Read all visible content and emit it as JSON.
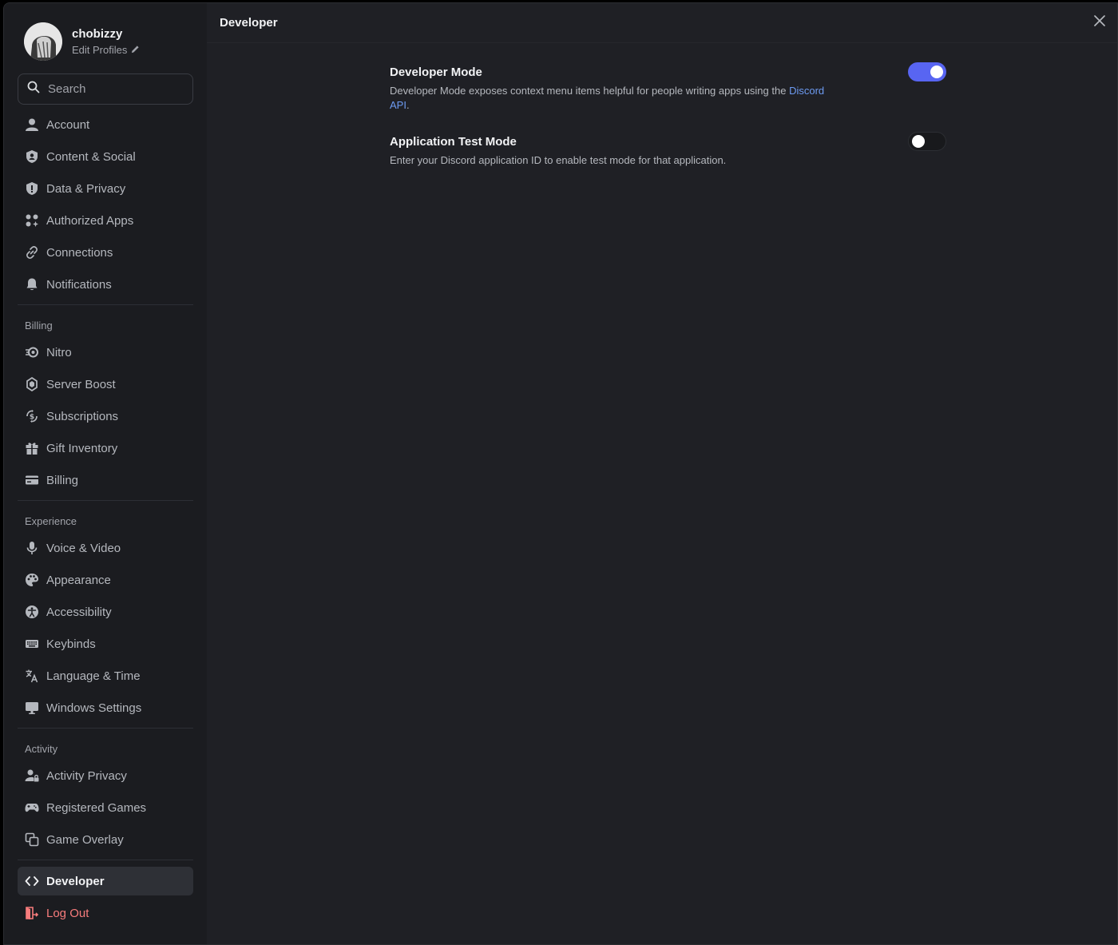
{
  "profile": {
    "username": "chobizzy",
    "edit_label": "Edit Profiles"
  },
  "search": {
    "placeholder": "Search"
  },
  "nav": {
    "user_items": [
      {
        "label": "Account",
        "icon": "user-icon"
      },
      {
        "label": "Content & Social",
        "icon": "shield-user-icon"
      },
      {
        "label": "Data & Privacy",
        "icon": "shield-icon"
      },
      {
        "label": "Authorized Apps",
        "icon": "apps-icon"
      },
      {
        "label": "Connections",
        "icon": "link-icon"
      },
      {
        "label": "Notifications",
        "icon": "bell-icon"
      }
    ],
    "billing_label": "Billing",
    "billing_items": [
      {
        "label": "Nitro",
        "icon": "nitro-icon"
      },
      {
        "label": "Server Boost",
        "icon": "boost-icon"
      },
      {
        "label": "Subscriptions",
        "icon": "subscriptions-icon"
      },
      {
        "label": "Gift Inventory",
        "icon": "gift-icon"
      },
      {
        "label": "Billing",
        "icon": "card-icon"
      }
    ],
    "experience_label": "Experience",
    "experience_items": [
      {
        "label": "Voice & Video",
        "icon": "mic-icon"
      },
      {
        "label": "Appearance",
        "icon": "palette-icon"
      },
      {
        "label": "Accessibility",
        "icon": "accessibility-icon"
      },
      {
        "label": "Keybinds",
        "icon": "keyboard-icon"
      },
      {
        "label": "Language & Time",
        "icon": "translate-icon"
      },
      {
        "label": "Windows Settings",
        "icon": "monitor-icon"
      }
    ],
    "activity_label": "Activity",
    "activity_items": [
      {
        "label": "Activity Privacy",
        "icon": "user-lock-icon"
      },
      {
        "label": "Registered Games",
        "icon": "gamepad-icon"
      },
      {
        "label": "Game Overlay",
        "icon": "overlay-icon"
      }
    ],
    "developer": {
      "label": "Developer",
      "icon": "code-icon"
    },
    "logout": {
      "label": "Log Out",
      "icon": "logout-icon"
    }
  },
  "header": {
    "title": "Developer"
  },
  "settings": {
    "dev_mode": {
      "title": "Developer Mode",
      "desc": "Developer Mode exposes context menu items helpful for people writing apps using the ",
      "link": "Discord API",
      "desc_end": ".",
      "enabled": true
    },
    "test_mode": {
      "title": "Application Test Mode",
      "desc": "Enter your Discord application ID to enable test mode for that application.",
      "enabled": false
    }
  },
  "colors": {
    "accent": "#5865f2",
    "link": "#6d9bf2",
    "danger": "#f77c7c"
  }
}
